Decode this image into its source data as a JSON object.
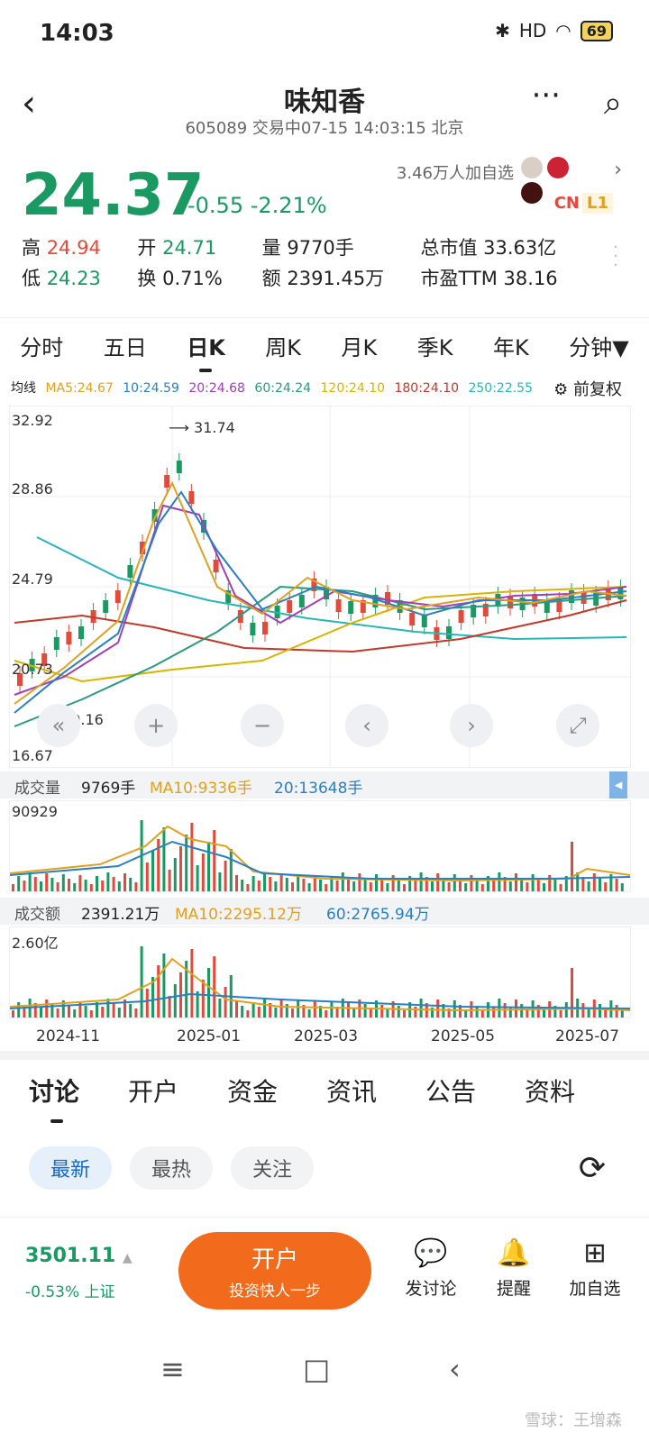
{
  "status": {
    "time": "14:03",
    "signal": "HD",
    "battery": "69"
  },
  "header": {
    "title": "味知香",
    "subtitle": "605089 交易中07-15 14:03:15 北京"
  },
  "quote": {
    "price": "24.37",
    "change": "-0.55 -2.21%",
    "watchers": "3.46万人加自选",
    "badge_cn": "CN",
    "badge_l1": "L1"
  },
  "stats": {
    "high_label": "高",
    "high": "24.94",
    "open_label": "开",
    "open": "24.71",
    "vol_label": "量",
    "vol": "9770手",
    "mcap_label": "总市值",
    "mcap": "33.63亿",
    "low_label": "低",
    "low": "24.23",
    "turn_label": "换",
    "turn": "0.71%",
    "amt_label": "额",
    "amt": "2391.45万",
    "pe_label": "市盈TTM",
    "pe": "38.16"
  },
  "tabs": [
    "分时",
    "五日",
    "日K",
    "周K",
    "月K",
    "季K",
    "年K",
    "分钟▼"
  ],
  "ma_line": {
    "label": "均线",
    "ma5": "MA5:24.67",
    "ma10": "10:24.59",
    "ma20": "20:24.68",
    "ma60": "60:24.24",
    "ma120": "120:24.10",
    "ma180": "180:24.10",
    "ma250": "250:22.55",
    "fuquan": "前复权"
  },
  "chart_data": {
    "type": "candlestick",
    "y_ticks": [
      "32.92",
      "28.86",
      "24.79",
      "20.73",
      "16.67"
    ],
    "high_mark": "31.74",
    "low_mark": "19.16",
    "x_ticks": [
      "2024-11",
      "2025-01",
      "2025-03",
      "2025-05",
      "2025-07"
    ],
    "volume": {
      "label": "成交量",
      "value": "9769手",
      "ma10": "MA10:9336手",
      "ma20": "20:13648手",
      "max": "90929"
    },
    "amount": {
      "label": "成交额",
      "value": "2391.21万",
      "ma10": "MA10:2295.12万",
      "ma60": "60:2765.94万",
      "max": "2.60亿"
    }
  },
  "discussion_tabs": [
    "讨论",
    "开户",
    "资金",
    "资讯",
    "公告",
    "资料"
  ],
  "chips": [
    "最新",
    "最热",
    "关注"
  ],
  "bottom": {
    "index": "3501.11",
    "index_sub": "-0.53% 上证",
    "open_main": "开户",
    "open_sub": "投资快人一步",
    "post": "发讨论",
    "alert": "提醒",
    "add": "加自选"
  },
  "watermark": "雪球：王增森"
}
